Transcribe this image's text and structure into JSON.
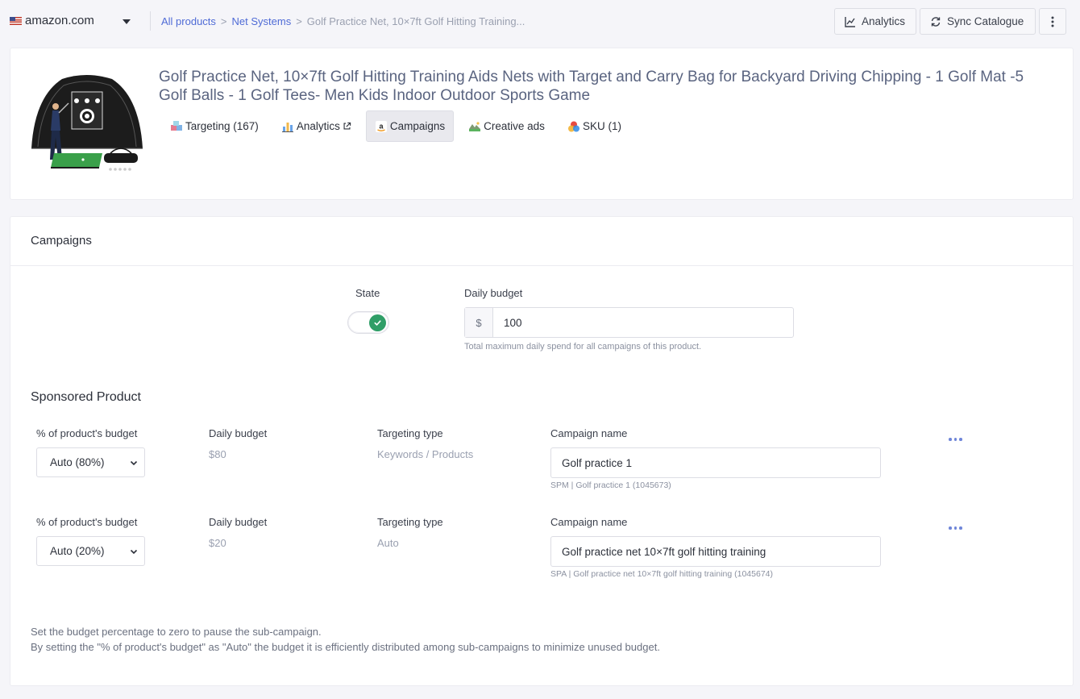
{
  "topbar": {
    "store": "amazon.com",
    "breadcrumb": {
      "root": "All products",
      "separator": ">",
      "brand": "Net Systems",
      "current": "Golf Practice Net, 10×7ft Golf Hitting Training..."
    },
    "analytics_label": "Analytics",
    "sync_label": "Sync Catalogue"
  },
  "product": {
    "title": "Golf Practice Net, 10×7ft Golf Hitting Training Aids Nets with Target and Carry Bag for Backyard Driving Chipping - 1 Golf Mat -5 Golf Balls - 1 Golf Tees- Men Kids Indoor Outdoor Sports Game",
    "tabs": [
      {
        "label": "Targeting (167)",
        "icon": "targeting-icon"
      },
      {
        "label": "Analytics",
        "icon": "bar-chart-icon"
      },
      {
        "label": "Campaigns",
        "icon": "amazon-icon",
        "active": true
      },
      {
        "label": "Creative ads",
        "icon": "landscape-icon"
      },
      {
        "label": "SKU (1)",
        "icon": "circles-icon"
      }
    ]
  },
  "campaigns": {
    "title": "Campaigns",
    "state_label": "State",
    "state_on": true,
    "daily_budget_label": "Daily budget",
    "currency": "$",
    "daily_budget_value": "100",
    "daily_budget_hint": "Total maximum daily spend for all campaigns of this product.",
    "sponsored_title": "Sponsored Product",
    "sub_campaigns": [
      {
        "pct_label": "% of product's budget",
        "pct_value": "Auto (80%)",
        "budget_label": "Daily budget",
        "budget_value": "$80",
        "targeting_label": "Targeting type",
        "targeting_value": "Keywords / Products",
        "name_label": "Campaign name",
        "name_value": "Golf practice 1",
        "name_hint": "SPM | Golf practice 1 (1045673)"
      },
      {
        "pct_label": "% of product's budget",
        "pct_value": "Auto (20%)",
        "budget_label": "Daily budget",
        "budget_value": "$20",
        "targeting_label": "Targeting type",
        "targeting_value": "Auto",
        "name_label": "Campaign name",
        "name_value": "Golf practice net 10×7ft golf hitting training",
        "name_hint": "SPA | Golf practice net 10×7ft golf hitting training (1045674)"
      }
    ],
    "footnote_1": "Set the budget percentage to zero to pause the sub-campaign.",
    "footnote_2": "By setting the \"% of product's budget\" as \"Auto\" the budget it is efficiently distributed among sub-campaigns to minimize unused budget."
  },
  "colors": {
    "accent": "#4f6bd6",
    "toggle_on": "#2f9e67",
    "title_text": "#5a6480"
  }
}
